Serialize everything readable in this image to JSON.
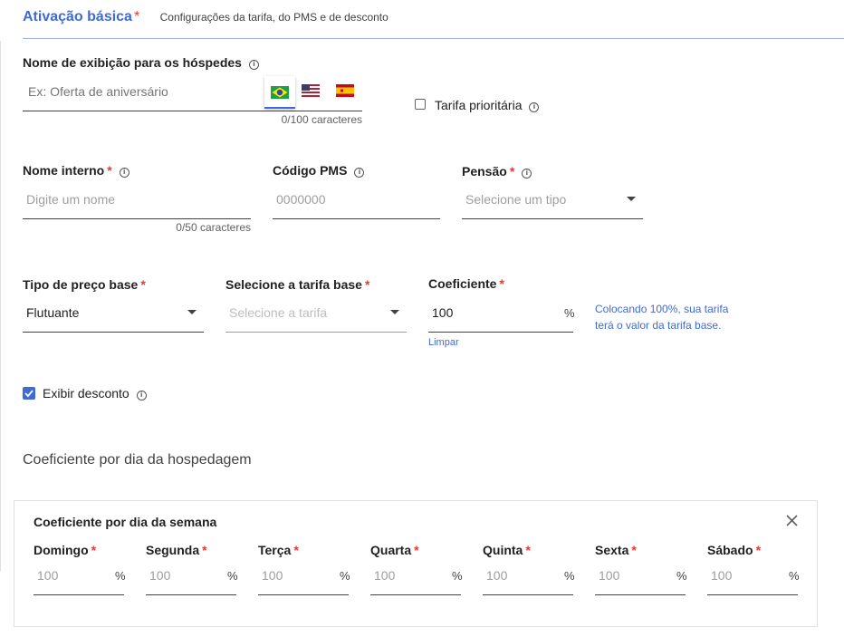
{
  "header": {
    "title": "Ativação básica",
    "required_mark": "*",
    "subtitle": "Configurações da tarifa, do PMS e de desconto"
  },
  "display_name": {
    "label": "Nome de exibição para os hóspedes",
    "placeholder": "Ex: Oferta de aniversário",
    "counter": "0/100 caracteres",
    "languages": [
      "pt-BR",
      "en-US",
      "es-ES"
    ]
  },
  "priority": {
    "label": "Tarifa prioritária",
    "checked": false
  },
  "internal_name": {
    "label": "Nome interno",
    "required_mark": "*",
    "placeholder": "Digite um nome",
    "counter": "0/50 caracteres"
  },
  "pms_code": {
    "label": "Código PMS",
    "placeholder": "0000000"
  },
  "board": {
    "label": "Pensão",
    "required_mark": "*",
    "placeholder": "Selecione um tipo"
  },
  "base_price_type": {
    "label": "Tipo de preço base",
    "required_mark": "*",
    "value": "Flutuante"
  },
  "base_rate": {
    "label": "Selecione a tarifa base",
    "required_mark": "*",
    "placeholder": "Selecione a tarifa"
  },
  "coefficient": {
    "label": "Coeficiente",
    "required_mark": "*",
    "value": "100",
    "unit": "%",
    "clear_label": "Limpar",
    "hint_line1": "Colocando 100%, sua tarifa",
    "hint_line2": "terá o valor da tarifa base."
  },
  "discount": {
    "label": "Exibir desconto",
    "checked": true
  },
  "stay_section": {
    "title": "Coeficiente por dia da hospedagem"
  },
  "weekday_card": {
    "title": "Coeficiente por dia da semana",
    "required_mark": "*",
    "unit": "%",
    "days": [
      {
        "label": "Domingo",
        "placeholder": "100"
      },
      {
        "label": "Segunda",
        "placeholder": "100"
      },
      {
        "label": "Terça",
        "placeholder": "100"
      },
      {
        "label": "Quarta",
        "placeholder": "100"
      },
      {
        "label": "Quinta",
        "placeholder": "100"
      },
      {
        "label": "Sexta",
        "placeholder": "100"
      },
      {
        "label": "Sábado",
        "placeholder": "100"
      }
    ]
  },
  "colors": {
    "accent": "#3f6ad8",
    "required": "#e53935",
    "checkbox": "#3f6ad8"
  }
}
